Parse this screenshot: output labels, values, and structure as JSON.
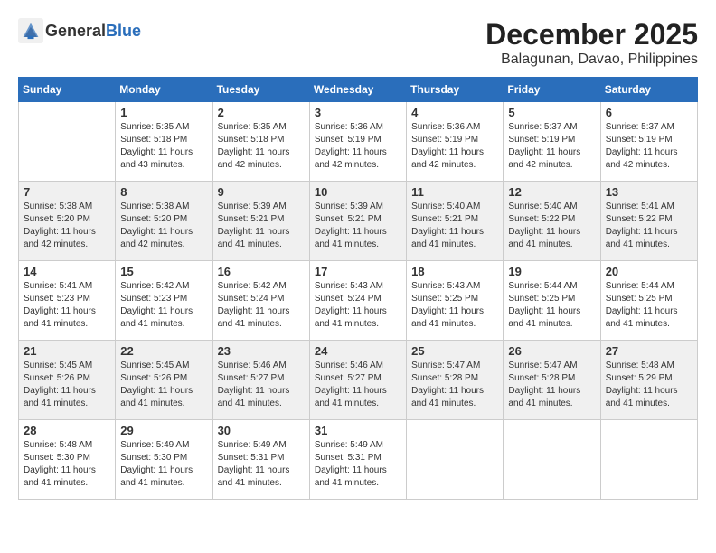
{
  "header": {
    "logo": {
      "general": "General",
      "blue": "Blue"
    },
    "month": "December 2025",
    "location": "Balagunan, Davao, Philippines"
  },
  "weekdays": [
    "Sunday",
    "Monday",
    "Tuesday",
    "Wednesday",
    "Thursday",
    "Friday",
    "Saturday"
  ],
  "weeks": [
    [
      {
        "day": "",
        "sunrise": "",
        "sunset": "",
        "daylight": ""
      },
      {
        "day": "1",
        "sunrise": "5:35 AM",
        "sunset": "5:18 PM",
        "hours": "11 hours and 43 minutes."
      },
      {
        "day": "2",
        "sunrise": "5:35 AM",
        "sunset": "5:18 PM",
        "hours": "11 hours and 42 minutes."
      },
      {
        "day": "3",
        "sunrise": "5:36 AM",
        "sunset": "5:19 PM",
        "hours": "11 hours and 42 minutes."
      },
      {
        "day": "4",
        "sunrise": "5:36 AM",
        "sunset": "5:19 PM",
        "hours": "11 hours and 42 minutes."
      },
      {
        "day": "5",
        "sunrise": "5:37 AM",
        "sunset": "5:19 PM",
        "hours": "11 hours and 42 minutes."
      },
      {
        "day": "6",
        "sunrise": "5:37 AM",
        "sunset": "5:19 PM",
        "hours": "11 hours and 42 minutes."
      }
    ],
    [
      {
        "day": "7",
        "sunrise": "5:38 AM",
        "sunset": "5:20 PM",
        "hours": "11 hours and 42 minutes."
      },
      {
        "day": "8",
        "sunrise": "5:38 AM",
        "sunset": "5:20 PM",
        "hours": "11 hours and 42 minutes."
      },
      {
        "day": "9",
        "sunrise": "5:39 AM",
        "sunset": "5:21 PM",
        "hours": "11 hours and 41 minutes."
      },
      {
        "day": "10",
        "sunrise": "5:39 AM",
        "sunset": "5:21 PM",
        "hours": "11 hours and 41 minutes."
      },
      {
        "day": "11",
        "sunrise": "5:40 AM",
        "sunset": "5:21 PM",
        "hours": "11 hours and 41 minutes."
      },
      {
        "day": "12",
        "sunrise": "5:40 AM",
        "sunset": "5:22 PM",
        "hours": "11 hours and 41 minutes."
      },
      {
        "day": "13",
        "sunrise": "5:41 AM",
        "sunset": "5:22 PM",
        "hours": "11 hours and 41 minutes."
      }
    ],
    [
      {
        "day": "14",
        "sunrise": "5:41 AM",
        "sunset": "5:23 PM",
        "hours": "11 hours and 41 minutes."
      },
      {
        "day": "15",
        "sunrise": "5:42 AM",
        "sunset": "5:23 PM",
        "hours": "11 hours and 41 minutes."
      },
      {
        "day": "16",
        "sunrise": "5:42 AM",
        "sunset": "5:24 PM",
        "hours": "11 hours and 41 minutes."
      },
      {
        "day": "17",
        "sunrise": "5:43 AM",
        "sunset": "5:24 PM",
        "hours": "11 hours and 41 minutes."
      },
      {
        "day": "18",
        "sunrise": "5:43 AM",
        "sunset": "5:25 PM",
        "hours": "11 hours and 41 minutes."
      },
      {
        "day": "19",
        "sunrise": "5:44 AM",
        "sunset": "5:25 PM",
        "hours": "11 hours and 41 minutes."
      },
      {
        "day": "20",
        "sunrise": "5:44 AM",
        "sunset": "5:25 PM",
        "hours": "11 hours and 41 minutes."
      }
    ],
    [
      {
        "day": "21",
        "sunrise": "5:45 AM",
        "sunset": "5:26 PM",
        "hours": "11 hours and 41 minutes."
      },
      {
        "day": "22",
        "sunrise": "5:45 AM",
        "sunset": "5:26 PM",
        "hours": "11 hours and 41 minutes."
      },
      {
        "day": "23",
        "sunrise": "5:46 AM",
        "sunset": "5:27 PM",
        "hours": "11 hours and 41 minutes."
      },
      {
        "day": "24",
        "sunrise": "5:46 AM",
        "sunset": "5:27 PM",
        "hours": "11 hours and 41 minutes."
      },
      {
        "day": "25",
        "sunrise": "5:47 AM",
        "sunset": "5:28 PM",
        "hours": "11 hours and 41 minutes."
      },
      {
        "day": "26",
        "sunrise": "5:47 AM",
        "sunset": "5:28 PM",
        "hours": "11 hours and 41 minutes."
      },
      {
        "day": "27",
        "sunrise": "5:48 AM",
        "sunset": "5:29 PM",
        "hours": "11 hours and 41 minutes."
      }
    ],
    [
      {
        "day": "28",
        "sunrise": "5:48 AM",
        "sunset": "5:30 PM",
        "hours": "11 hours and 41 minutes."
      },
      {
        "day": "29",
        "sunrise": "5:49 AM",
        "sunset": "5:30 PM",
        "hours": "11 hours and 41 minutes."
      },
      {
        "day": "30",
        "sunrise": "5:49 AM",
        "sunset": "5:31 PM",
        "hours": "11 hours and 41 minutes."
      },
      {
        "day": "31",
        "sunrise": "5:49 AM",
        "sunset": "5:31 PM",
        "hours": "11 hours and 41 minutes."
      },
      {
        "day": "",
        "sunrise": "",
        "sunset": "",
        "hours": ""
      },
      {
        "day": "",
        "sunrise": "",
        "sunset": "",
        "hours": ""
      },
      {
        "day": "",
        "sunrise": "",
        "sunset": "",
        "hours": ""
      }
    ]
  ],
  "labels": {
    "sunrise_prefix": "Sunrise: ",
    "sunset_prefix": "Sunset: ",
    "daylight_prefix": "Daylight: "
  }
}
